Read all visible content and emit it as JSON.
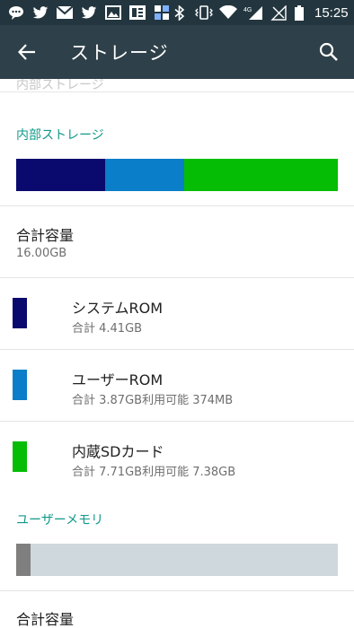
{
  "status_bar": {
    "time": "15:25",
    "network_type": "4G",
    "left_icons": [
      "chat-icon",
      "twitter-icon",
      "mail-icon",
      "twitter-icon",
      "image-icon",
      "newspaper-icon",
      "grid-app-icon"
    ],
    "right_icons": [
      "bluetooth-icon",
      "vibrate-icon",
      "wifi-icon",
      "signal-icon",
      "no-sim-icon",
      "battery-icon"
    ]
  },
  "app_bar": {
    "title": "ストレージ",
    "back_icon": "arrow-back-icon",
    "search_icon": "search-icon"
  },
  "faded_header": "内部ストレージ",
  "internal": {
    "header": "内部ストレージ",
    "bar_fractions": [
      0.276,
      0.245,
      0.479
    ],
    "bar_colors": [
      "#0a0a6e",
      "#0a7ec8",
      "#04bd04"
    ],
    "total_label": "合計容量",
    "total_value": "16.00GB",
    "items": [
      {
        "name": "システムROM",
        "detail": "合計 4.41GB",
        "color": "#0a0a6e"
      },
      {
        "name": "ユーザーROM",
        "detail": "合計 3.87GB利用可能 374MB",
        "color": "#0a7ec8"
      },
      {
        "name": "内蔵SDカード",
        "detail": "合計 7.71GB利用可能 7.38GB",
        "color": "#04bd04"
      }
    ]
  },
  "memory": {
    "header": "ユーザーメモリ",
    "used_fraction": 0.045,
    "used_color": "#7f7f7f",
    "free_color": "#cfd8dc",
    "total_label": "合計容量"
  },
  "colors": {
    "status_bar": "#23363f",
    "app_bar": "#2e4049",
    "accent": "#11998a"
  }
}
